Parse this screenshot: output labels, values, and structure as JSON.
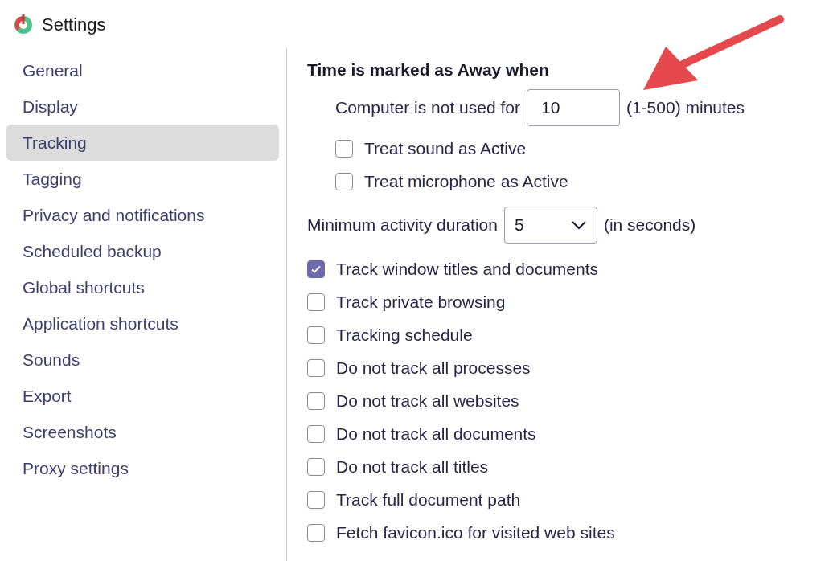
{
  "window": {
    "title": "Settings"
  },
  "sidebar": {
    "items": [
      {
        "label": "General",
        "selected": false
      },
      {
        "label": "Display",
        "selected": false
      },
      {
        "label": "Tracking",
        "selected": true
      },
      {
        "label": "Tagging",
        "selected": false
      },
      {
        "label": "Privacy and notifications",
        "selected": false
      },
      {
        "label": "Scheduled backup",
        "selected": false
      },
      {
        "label": "Global shortcuts",
        "selected": false
      },
      {
        "label": "Application shortcuts",
        "selected": false
      },
      {
        "label": "Sounds",
        "selected": false
      },
      {
        "label": "Export",
        "selected": false
      },
      {
        "label": "Screenshots",
        "selected": false
      },
      {
        "label": "Proxy settings",
        "selected": false
      }
    ]
  },
  "away": {
    "heading": "Time is marked as Away when",
    "idle_label": "Computer is not used for",
    "idle_value": "10",
    "idle_hint": "(1-500) minutes",
    "options": [
      {
        "label": "Treat sound as Active",
        "checked": false
      },
      {
        "label": "Treat microphone as Active",
        "checked": false
      }
    ]
  },
  "min_activity": {
    "label": "Minimum activity duration",
    "value": "5",
    "unit": "(in seconds)"
  },
  "options": [
    {
      "label": "Track window titles and documents",
      "checked": true
    },
    {
      "label": "Track private browsing",
      "checked": false
    },
    {
      "label": "Tracking schedule",
      "checked": false
    },
    {
      "label": "Do not track all processes",
      "checked": false
    },
    {
      "label": "Do not track all websites",
      "checked": false
    },
    {
      "label": "Do not track all documents",
      "checked": false
    },
    {
      "label": "Do not track all titles",
      "checked": false
    },
    {
      "label": "Track full document path",
      "checked": false
    },
    {
      "label": "Fetch favicon.ico for visited web sites",
      "checked": false
    }
  ]
}
